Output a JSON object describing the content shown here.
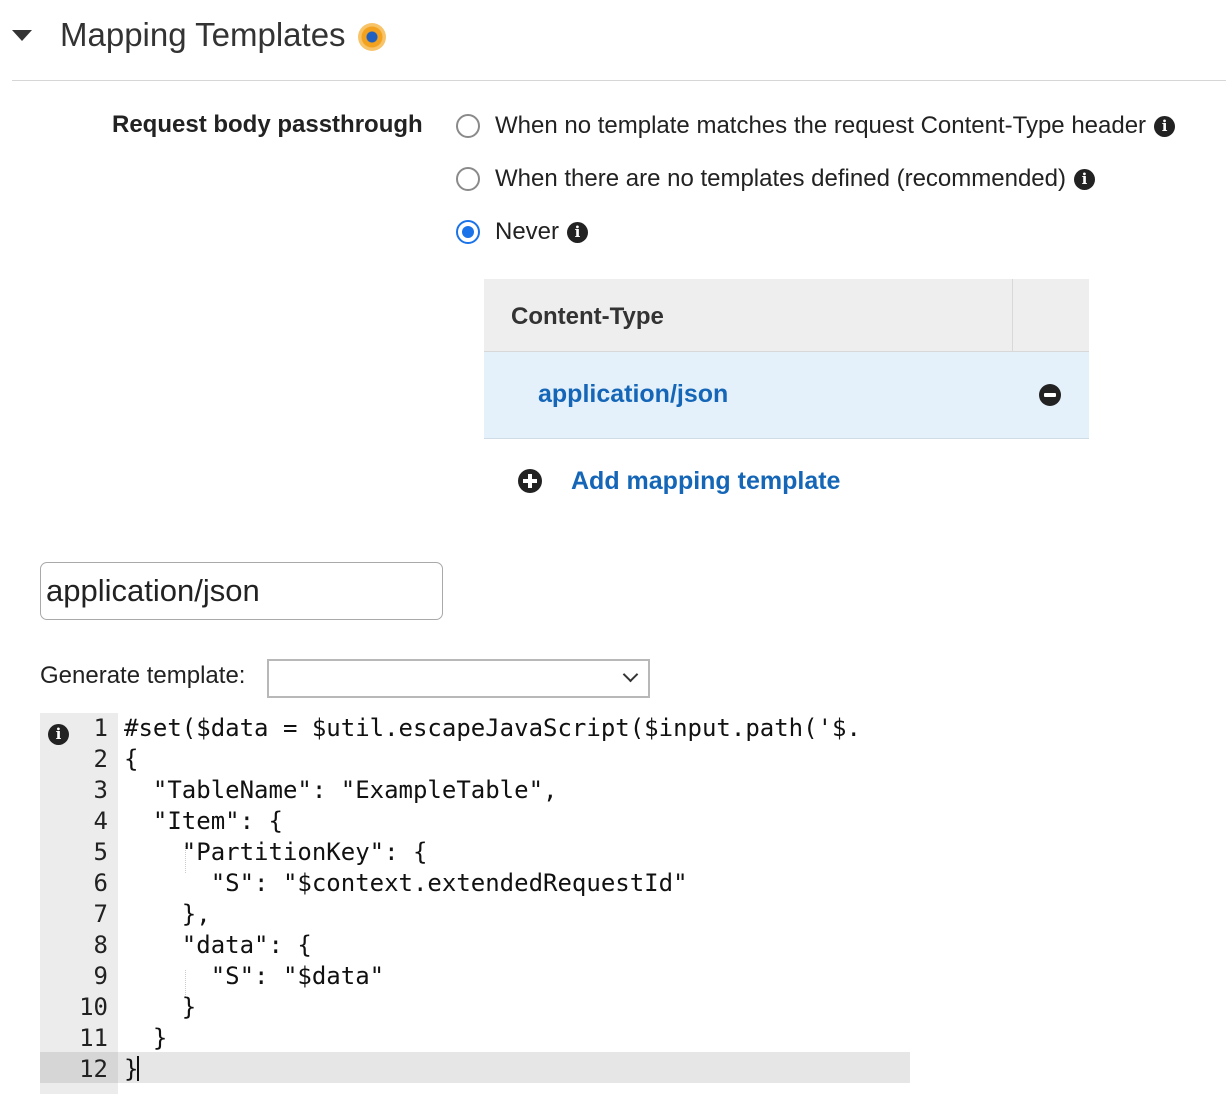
{
  "section": {
    "title": "Mapping Templates"
  },
  "passthrough": {
    "label": "Request body passthrough",
    "options": [
      {
        "label": "When no template matches the request Content-Type header",
        "selected": false
      },
      {
        "label": "When there are no templates defined (recommended)",
        "selected": false
      },
      {
        "label": "Never",
        "selected": true
      }
    ],
    "info_glyph": "i"
  },
  "content_types": {
    "header": "Content-Type",
    "rows": [
      {
        "value": "application/json"
      }
    ],
    "add_label": "Add mapping template"
  },
  "template_editor": {
    "content_type_value": "application/json",
    "generate_label": "Generate template:",
    "generate_selected": "",
    "line_numbers": [
      "1",
      "2",
      "3",
      "4",
      "5",
      "6",
      "7",
      "8",
      "9",
      "10",
      "11",
      "12"
    ],
    "lines": [
      "#set($data = $util.escapeJavaScript($input.path('$.",
      "{",
      "  \"TableName\": \"ExampleTable\",",
      "  \"Item\": {",
      "    \"PartitionKey\": {",
      "      \"S\": \"$context.extendedRequestId\"",
      "    },",
      "    \"data\": {",
      "      \"S\": \"$data\"",
      "    }",
      "  }",
      "}"
    ],
    "active_line": 12
  },
  "colors": {
    "accent": "#1a73e8",
    "link": "#1566b7",
    "selected_row_bg": "#e4f1fb",
    "status_dot_outer": "#f3a21f",
    "status_dot_inner": "#1f5fbf"
  },
  "icons": {
    "collapse": "caret-down-icon",
    "status": "status-dot-icon",
    "info": "info-icon",
    "remove": "minus-circle-icon",
    "add": "plus-circle-icon",
    "dropdown": "chevron-down-icon"
  }
}
